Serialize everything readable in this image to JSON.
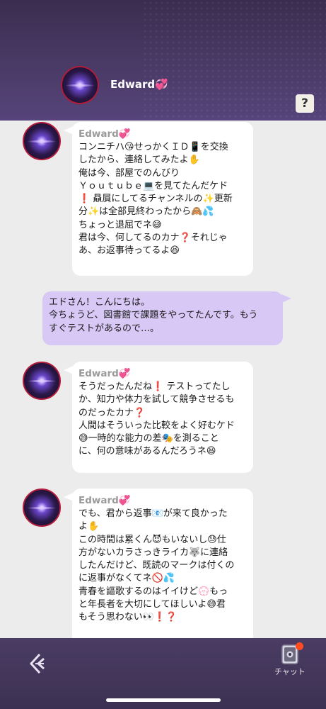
{
  "header": {
    "name": "Edward💞",
    "help_label": "?"
  },
  "messages": [
    {
      "sender": "Edward💞",
      "text": "コンニチハ😘せっかくＩＤ📱を交換\nしたから、連絡してみたよ✋\n俺は今、部屋でのんびり\nＹｏｕｔｕｂｅ💻を見てたんだケド\n❗ 贔屓にしてるチャンネルの✨更新\n分✨は全部見終わったから🙈💦\nちょっと退屈でネ😅\n君は今、何してるのカナ❓それじゃ\nあ、お返事待ってるよ😆"
    },
    {
      "text": "エドさん！こんにちは。\n今ちょうど、図書館で課題をやってたんです。もう\nすぐテストがあるので…。"
    },
    {
      "sender": "Edward💞",
      "text": "そうだったんだね❗ テストってたし\nか、知力や体力を試して競争させるも\nのだったカナ❓\n人間はそういった比較をよく好むケド\n😅一時的な能力の差🎭を測ること\nに、何の意味があるんだろうネ😆"
    },
    {
      "sender": "Edward💞",
      "text": "でも、君から返事📧が来て良かった\nよ✋\nこの時間は累くん😈もいないし😓仕\n方がないカラさっきライカ🐺に連絡\nしたんだけど、既読のマークは付くの\nに返事がなくてネ🚫💦\n青春を謳歌するのはイイけど💮もっ\nと年長者を大切にしてほしいよ😅君\nもそう思わない👀❗❓"
    }
  ],
  "footer": {
    "chat_tab_label": "チャット",
    "chat_icon": "chat-book-icon",
    "back_icon": "back-arrow-icon"
  },
  "colors": {
    "header_bg": "#4a3a66",
    "outgoing_bubble": "#d7c8f5",
    "incoming_bubble": "#ffffff",
    "notification_dot": "#ff4b1f"
  }
}
